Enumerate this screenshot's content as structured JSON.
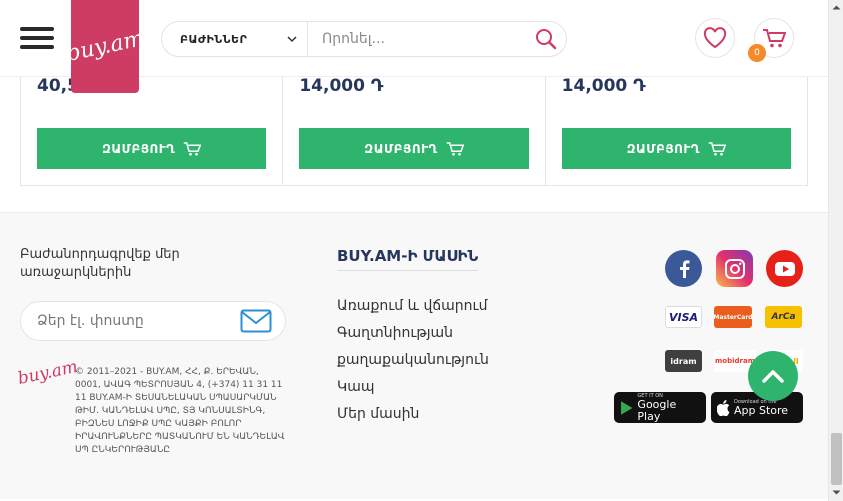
{
  "products": [
    {
      "price": "40,500 Դ",
      "button_label": "ԶԱՄԲՅՈՒՂ"
    },
    {
      "price": "14,000 Դ",
      "button_label": "ԶԱՄԲՅՈՒՂ"
    },
    {
      "price": "14,000 Դ",
      "button_label": "ԶԱՄԲՅՈՒՂ"
    }
  ],
  "header": {
    "logo_text": "buy.am",
    "categories_label": "ԲԱԺԻՆՆԵՐ",
    "search_placeholder": "Որոնել...",
    "cart_count": "0"
  },
  "footer": {
    "subscribe_text": "Բաժանորդագրվեք մեր առաջարկներին",
    "email_placeholder": "Ձեր էլ. փոստը",
    "logo_text": "buy.am",
    "copyright": "© 2011–2021 - BUY.AM, ՀՀ, Ք. ԵՐԵՎԱՆ, 0001, ԱՎԱԳ ՊԵՏՐՈՍՅԱՆ 4, (+374) 11 31 11 11 BUY.AM-Ի ՏԵՍԱՆԵԼԱԿԱՆ ՍՊԱՍԱՐԿՄԱՆ ԹԻՄ. ԿԱՆԴԵԼԱՎ ՍՊԸ, ՏՅ ԿՈՆՍԱԼՏԻՆԳ, ԲԻԶՆԵՍ ԼՈՋԻՔ ՍՊԸ ԿԱՅՔԻ ԲՈԼՈՐ ԻՐԱՎՈՒՆՔՆԵՐԸ ՊԱՏԿԱՆՈՒՄ ԵՆ ԿԱՆԴԵԼԱՎ ՍՊ ԸՆԿԵՐՈՒԹՅԱՆԸ",
    "about_heading": "BUY.AM-Ի ՄԱՍԻՆ",
    "about_links": [
      "Առաքում և վճարում",
      "Գաղտնիության",
      "քաղաքականություն",
      "Կապ",
      "Մեր մասին"
    ],
    "payments": [
      "VISA",
      "MasterCard",
      "ArCa",
      "idram",
      "mobidram",
      "TelCell"
    ],
    "stores": [
      {
        "small": "GET IT ON",
        "large": "Google Play"
      },
      {
        "small": "Download on the",
        "large": "App Store"
      }
    ]
  },
  "colors": {
    "accent_green": "#2fb46e",
    "brand_pink": "#ce3b63",
    "price_navy": "#26365c",
    "badge_orange": "#f58a2b"
  }
}
